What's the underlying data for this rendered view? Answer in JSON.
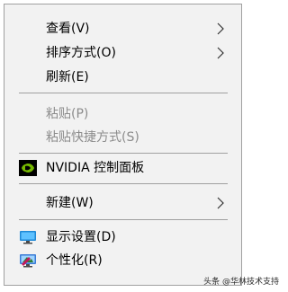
{
  "menu": {
    "items": [
      {
        "label": "查看(V)",
        "submenu": true,
        "disabled": false,
        "icon": ""
      },
      {
        "label": "排序方式(O)",
        "submenu": true,
        "disabled": false,
        "icon": ""
      },
      {
        "label": "刷新(E)",
        "submenu": false,
        "disabled": false,
        "icon": ""
      },
      {
        "label": "粘贴(P)",
        "submenu": false,
        "disabled": true,
        "icon": ""
      },
      {
        "label": "粘贴快捷方式(S)",
        "submenu": false,
        "disabled": true,
        "icon": ""
      },
      {
        "label": "NVIDIA 控制面板",
        "submenu": false,
        "disabled": false,
        "icon": "nvidia-icon"
      },
      {
        "label": "新建(W)",
        "submenu": true,
        "disabled": false,
        "icon": ""
      },
      {
        "label": "显示设置(D)",
        "submenu": false,
        "disabled": false,
        "icon": "display-settings-icon"
      },
      {
        "label": "个性化(R)",
        "submenu": false,
        "disabled": false,
        "icon": "personalize-icon"
      }
    ]
  },
  "watermark": "头条 @华林技术支持",
  "colors": {
    "menu_background": "#f2f2f2",
    "menu_border": "#a0a0a0",
    "disabled_text": "#8c8c8c",
    "nvidia_green": "#76b900"
  }
}
